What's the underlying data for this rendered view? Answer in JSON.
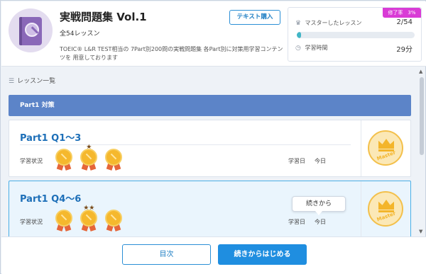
{
  "header": {
    "title": "実戦問題集 Vol.1",
    "lesson_count": "全54レッスン",
    "description": "TOEIC® L&R TEST相当の 7Part別200問の実戦問題集 各Part別に対策用学習コンテンツを 用意しております",
    "buy_button": "テキスト購入",
    "book_icon": "book-icon"
  },
  "stats": {
    "mastery_badge": "修了率　3%",
    "mastered_label": "マスターしたレッスン",
    "mastered_value": "2/54",
    "progress_fraction": 0.037,
    "study_time_label": "学習時間",
    "study_time_value": "29分",
    "icons": [
      "crown-icon",
      "clock-icon"
    ]
  },
  "list": {
    "heading": "レッスン一覧",
    "section": "Part1 対策",
    "cards": [
      {
        "title": "Part1 Q1～3",
        "status_label": "学習状況",
        "date_label": "学習日",
        "date_value": "今日",
        "medal_stars": [
          0,
          1,
          0
        ],
        "master_text": "Master"
      },
      {
        "title": "Part1 Q4～6",
        "status_label": "学習状況",
        "date_label": "学習日",
        "date_value": "今日",
        "medal_stars": [
          0,
          2,
          0
        ],
        "master_text": "Master",
        "tooltip": "続きから"
      }
    ]
  },
  "footer": {
    "toc_button": "目次",
    "start_button": "続きからはじめる"
  },
  "colors": {
    "accent": "#1f8ee0",
    "section_bar": "#5c84c8",
    "mastery_badge": "#d93bd6",
    "progress": "#42b6c6",
    "medal": "#f5b82d"
  }
}
